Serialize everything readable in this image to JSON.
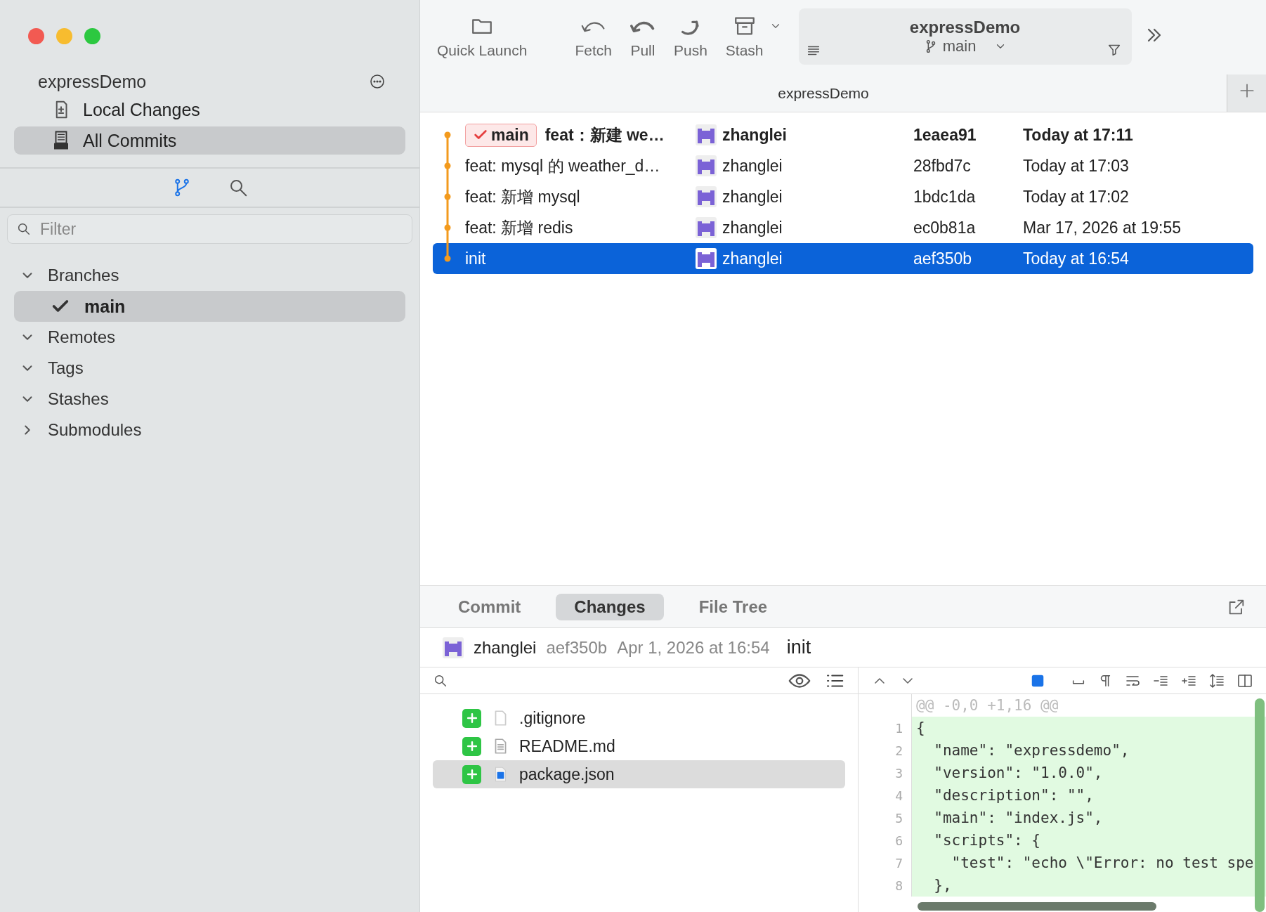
{
  "sidebar": {
    "repo_title": "expressDemo",
    "nav": [
      {
        "label": "Local Changes",
        "kind": "changes",
        "selected": false
      },
      {
        "label": "All Commits",
        "kind": "commits",
        "selected": true
      }
    ],
    "views": [
      {
        "kind": "branches",
        "selected": true
      },
      {
        "kind": "search",
        "selected": false
      }
    ],
    "filter": {
      "placeholder": "Filter"
    },
    "sections": [
      {
        "label": "Branches",
        "expanded": true,
        "children": [
          {
            "label": "main",
            "current": true,
            "selected": true
          }
        ]
      },
      {
        "label": "Remotes",
        "expanded": true
      },
      {
        "label": "Tags",
        "expanded": true
      },
      {
        "label": "Stashes",
        "expanded": true
      },
      {
        "label": "Submodules",
        "expanded": false
      }
    ]
  },
  "toolbar": {
    "buttons": [
      {
        "label": "Quick Launch",
        "kind": "launch"
      },
      {
        "label": "Fetch",
        "kind": "fetch"
      },
      {
        "label": "Pull",
        "kind": "pull"
      },
      {
        "label": "Push",
        "kind": "push"
      },
      {
        "label": "Stash",
        "kind": "stash"
      }
    ],
    "repo": {
      "title": "expressDemo",
      "branch": "main"
    }
  },
  "tabs": [
    {
      "label": "expressDemo",
      "selected": true
    }
  ],
  "commits": [
    {
      "ref": "main",
      "subject": "feat：新建 we…",
      "author": "zhanglei",
      "hash": "1eaea91",
      "date": "Today at 17:11",
      "head": true,
      "selected": false
    },
    {
      "subject": "feat: mysql 的 weather_d…",
      "author": "zhanglei",
      "hash": "28fbd7c",
      "date": "Today at 17:03",
      "head": false,
      "selected": false
    },
    {
      "subject": "feat: 新增 mysql",
      "author": "zhanglei",
      "hash": "1bdc1da",
      "date": "Today at 17:02",
      "head": false,
      "selected": false
    },
    {
      "subject": "feat: 新增 redis",
      "author": "zhanglei",
      "hash": "ec0b81a",
      "date": "Mar 17, 2026 at 19:55",
      "head": false,
      "selected": false
    },
    {
      "subject": "init",
      "author": "zhanglei",
      "hash": "aef350b",
      "date": "Today at 16:54",
      "head": false,
      "selected": true
    }
  ],
  "detail_tabs": [
    {
      "label": "Commit",
      "selected": false
    },
    {
      "label": "Changes",
      "selected": true
    },
    {
      "label": "File Tree",
      "selected": false
    }
  ],
  "commit_info": {
    "author": "zhanglei",
    "hash": "aef350b",
    "date": "Apr 1, 2026 at 16:54",
    "message": "init"
  },
  "files": [
    {
      "name": ".gitignore",
      "added": true,
      "kind": "blank",
      "selected": false
    },
    {
      "name": "README.md",
      "added": true,
      "kind": "text",
      "selected": false
    },
    {
      "name": "package.json",
      "added": true,
      "kind": "json",
      "selected": true
    }
  ],
  "diff": {
    "hunk_header": "@@ -0,0 +1,16 @@",
    "lines": [
      {
        "number": "1",
        "text": "{",
        "added": true
      },
      {
        "number": "2",
        "text": "  \"name\": \"expressdemo\",",
        "added": true
      },
      {
        "number": "3",
        "text": "  \"version\": \"1.0.0\",",
        "added": true
      },
      {
        "number": "4",
        "text": "  \"description\": \"\",",
        "added": true
      },
      {
        "number": "5",
        "text": "  \"main\": \"index.js\",",
        "added": true
      },
      {
        "number": "6",
        "text": "  \"scripts\": {",
        "added": true
      },
      {
        "number": "7",
        "text": "    \"test\": \"echo \\\"Error: no test spe",
        "added": true
      },
      {
        "number": "8",
        "text": "  },",
        "added": true
      }
    ]
  }
}
